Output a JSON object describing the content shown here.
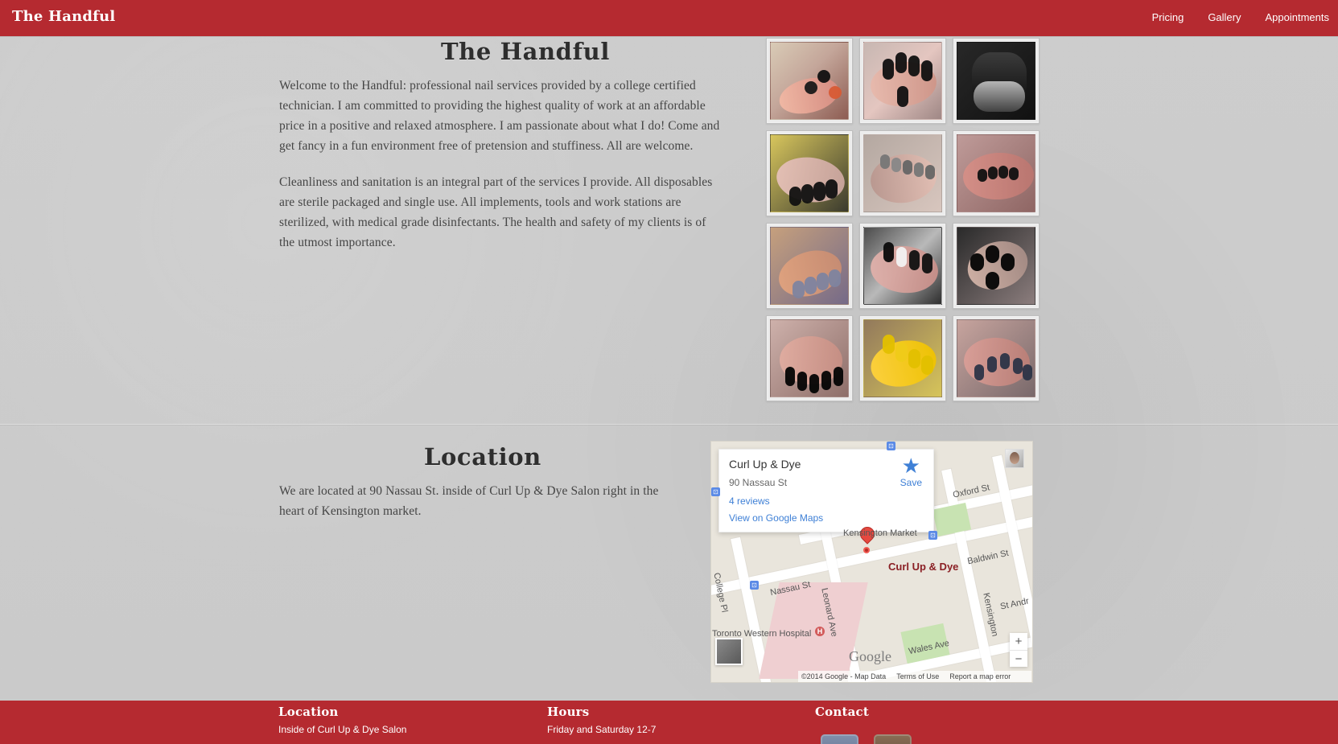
{
  "header": {
    "brand": "The Handful",
    "nav": [
      "Pricing",
      "Gallery",
      "Appointments"
    ]
  },
  "main": {
    "title": "The Handful",
    "paragraphs": [
      "Welcome to the Handful: professional nail services provided by a college certified technician. I am committed to providing the highest quality of work at an affordable price in a positive and relaxed atmosphere. I am passionate about what I do! Come and get fancy in a fun environment free of pretension and stuffiness. All are welcome.",
      "Cleanliness and sanitation is an integral part of the services I provide. All disposables are sterile packaged and single use. All implements, tools and work stations are sterilized, with medical grade disinfectants. The health and safety of my clients is of the utmost importance."
    ],
    "gallery_items": 12
  },
  "location": {
    "title": "Location",
    "text": "We are located at 90 Nassau St. inside of Curl Up & Dye Salon right in the heart of Kensington market."
  },
  "map": {
    "place_name": "Curl Up & Dye",
    "address": "90 Nassau St",
    "reviews": "4 reviews",
    "maps_link": "View on Google Maps",
    "save_label": "Save",
    "marker_label": "Curl Up & Dye",
    "streets": {
      "oxford": "Oxford St",
      "baldwin": "Baldwin St",
      "nassau": "Nassau St",
      "college": "College Pl",
      "leonard": "Leonard Ave",
      "kensington": "Kensington",
      "wales": "Wales Ave",
      "st_andrew": "St Andr"
    },
    "place_labels": {
      "hospital": "Toronto Western Hospital",
      "market": "Kensington Market"
    },
    "zoom_in": "+",
    "zoom_out": "−",
    "logo": "Google",
    "footer": {
      "copyright": "©2014 Google - Map Data",
      "terms": "Terms of Use",
      "report": "Report a map error"
    }
  },
  "footer": {
    "location_title": "Location",
    "location_text": "Inside of Curl Up & Dye Salon",
    "hours_title": "Hours",
    "hours_text": "Friday and Saturday 12-7",
    "contact_title": "Contact"
  },
  "colors": {
    "brand_red": "#b52a30",
    "page_gray": "#cccccc",
    "map_blue": "#3f80d6"
  },
  "icons": {
    "save": "star-icon",
    "marker": "map-pin-icon",
    "hospital": "hospital-icon",
    "bus": "bus-stop-icon",
    "facebook": "facebook-icon",
    "instagram": "instagram-icon"
  }
}
